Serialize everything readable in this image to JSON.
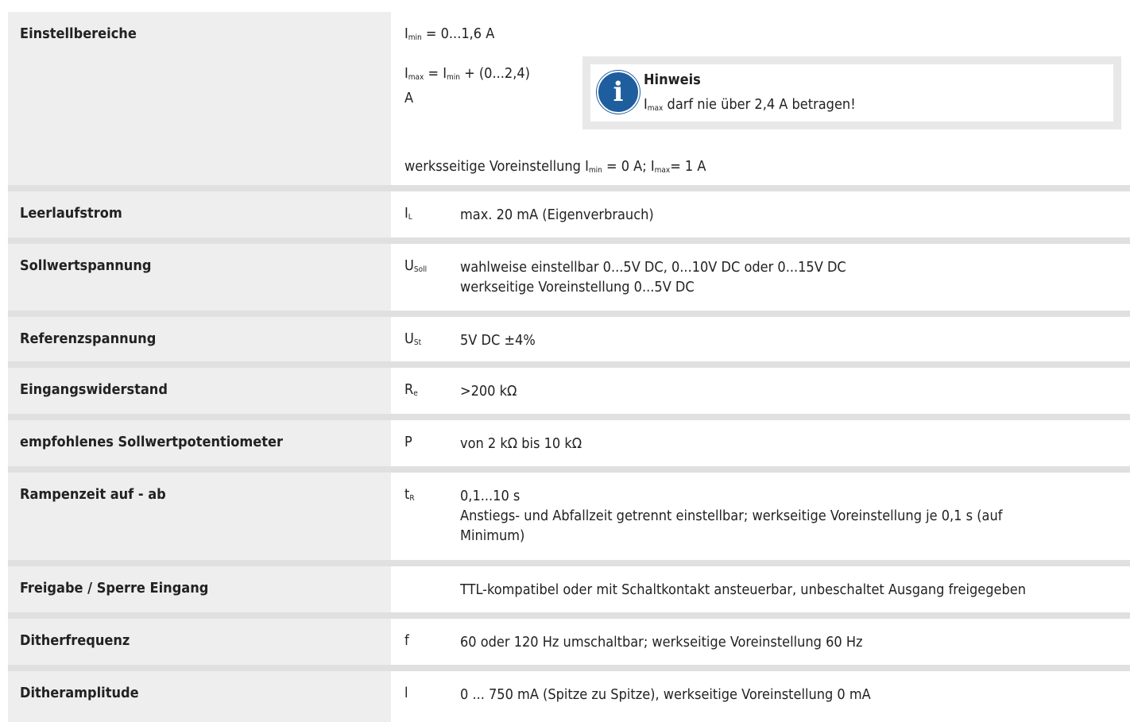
{
  "rows": [
    {
      "label": "Einstellbereiche",
      "line1": {
        "a": "I",
        "a_sub": "min",
        "b": " = 0...1,6 A"
      },
      "line2": {
        "a": "I",
        "a_sub": "max",
        "b": " = I",
        "b_sub": "min",
        "c": " + (0...2,4)",
        "d": "A"
      },
      "line3": {
        "a": "werksseitige Voreinstellung I",
        "a_sub": "min",
        "b": " = 0 A; I",
        "b_sub": "max",
        "c": "= 1 A"
      },
      "note": {
        "icon": "info-icon",
        "icon_glyph": "i",
        "title": "Hinweis",
        "text_sym": "I",
        "text_sub": "max",
        "text": " darf nie über 2,4 A betragen!"
      }
    },
    {
      "label": "Leerlaufstrom",
      "sym": "I",
      "sym_sub": "L",
      "lines": [
        "max. 20 mA (Eigenverbrauch)"
      ]
    },
    {
      "label": "Sollwertspannung",
      "sym": "U",
      "sym_sub": "Soll",
      "lines": [
        "wahlweise einstellbar 0...5V DC, 0...10V DC oder 0...15V DC",
        "werkseitige Voreinstellung 0...5V DC"
      ]
    },
    {
      "label": "Referenzspannung",
      "sym": "U",
      "sym_sub": "St",
      "lines": [
        "5V DC ±4%"
      ]
    },
    {
      "label": "Eingangswiderstand",
      "sym": "R",
      "sym_sub": "e",
      "lines": [
        ">200 kΩ"
      ]
    },
    {
      "label": "empfohlenes Sollwertpotentiometer",
      "sym": "P",
      "sym_sub": "",
      "lines": [
        "von 2 kΩ bis 10 kΩ"
      ]
    },
    {
      "label": "Rampenzeit auf - ab",
      "sym": "t",
      "sym_sub": "R",
      "lines": [
        "0,1...10 s",
        "Anstiegs- und Abfallzeit getrennt einstellbar; werkseitige Voreinstellung je 0,1 s (auf",
        "Minimum)"
      ]
    },
    {
      "label": "Freigabe / Sperre Eingang",
      "sym": "",
      "sym_sub": "",
      "lines": [
        "TTL-kompatibel oder mit Schaltkontakt ansteuerbar, unbeschaltet Ausgang freigegeben"
      ]
    },
    {
      "label": "Ditherfrequenz",
      "sym": "f",
      "sym_sub": "",
      "lines": [
        "60 oder 120 Hz umschaltbar; werkseitige Voreinstellung 60 Hz"
      ]
    },
    {
      "label": "Ditheramplitude",
      "sym": "l",
      "sym_sub": "",
      "lines": [
        "0 ... 750 mA (Spitze zu Spitze), werkseitige Voreinstellung 0 mA"
      ]
    }
  ]
}
